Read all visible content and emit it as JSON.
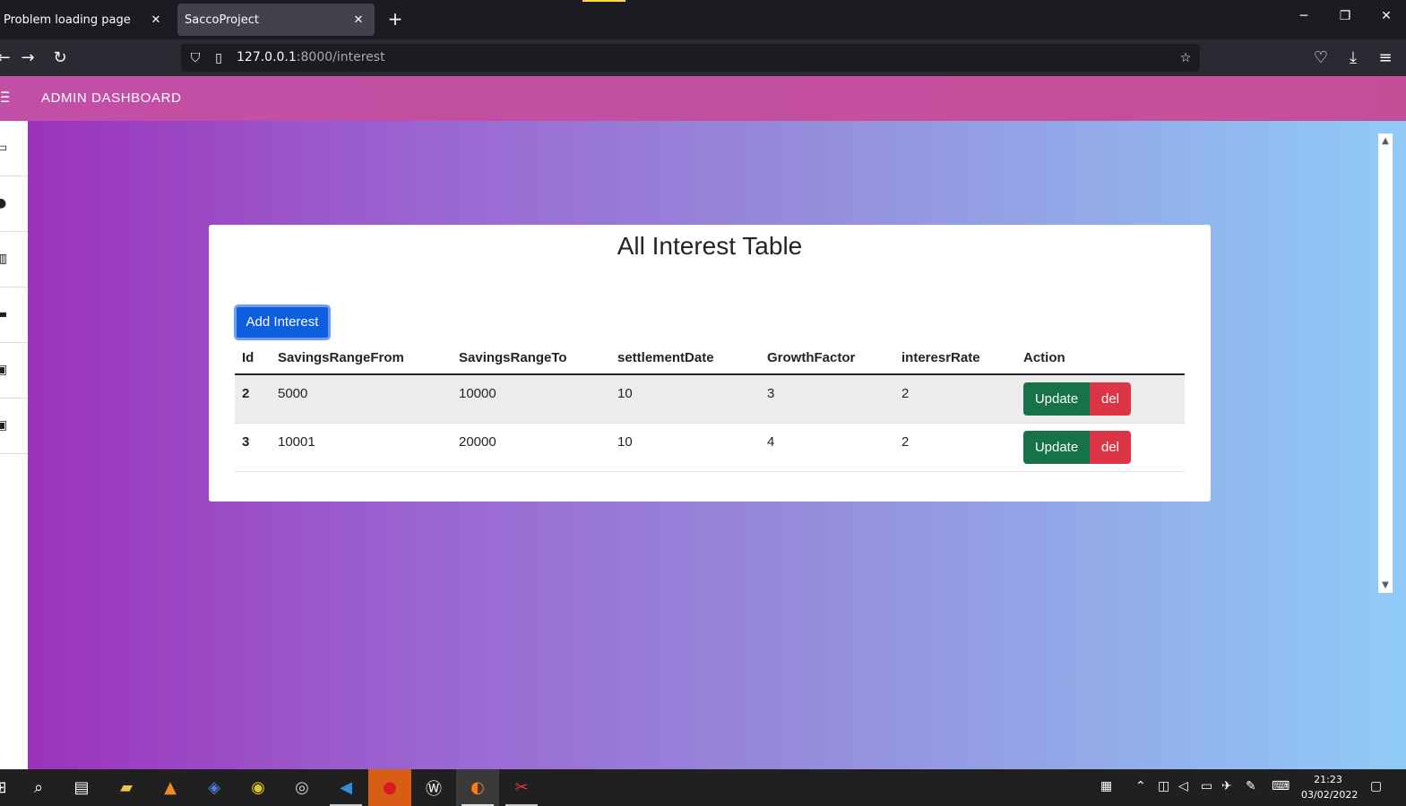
{
  "browser": {
    "tabs": [
      {
        "label": "Problem loading page",
        "close": "✕"
      },
      {
        "label": "SaccoProject",
        "close": "✕"
      }
    ],
    "new_tab": "+",
    "window_controls": {
      "minimize": "─",
      "restore": "❐",
      "close": "✕"
    },
    "url_host": "127.0.0.1",
    "url_rest": ":8000/interest"
  },
  "app": {
    "header_title": "ADMIN DASHBOARD"
  },
  "card": {
    "title": "All Interest Table",
    "add_button": "Add Interest",
    "columns": [
      "Id",
      "SavingsRangeFrom",
      "SavingsRangeTo",
      "settlementDate",
      "GrowthFactor",
      "interesrRate",
      "Action"
    ],
    "rows": [
      {
        "id": "2",
        "from": "5000",
        "to": "10000",
        "settlement": "10",
        "growth": "3",
        "rate": "2"
      },
      {
        "id": "3",
        "from": "10001",
        "to": "20000",
        "settlement": "10",
        "growth": "4",
        "rate": "2"
      }
    ],
    "update_label": "Update",
    "delete_label": "del"
  },
  "taskbar": {
    "time": "21:23",
    "date": "03/02/2022"
  }
}
